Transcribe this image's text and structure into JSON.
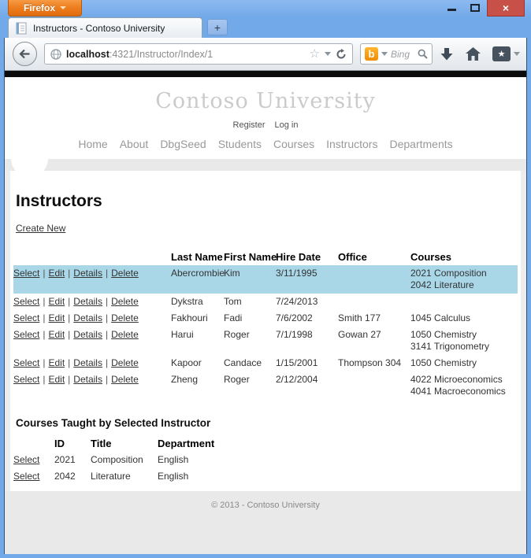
{
  "browser": {
    "menu_button_label": "Firefox",
    "tab_title": "Instructors - Contoso University",
    "new_tab_glyph": "+",
    "close_glyph": "×",
    "url": {
      "host": "localhost",
      "rest": ":4321/Instructor/Index/1"
    },
    "url_star_glyph": "☆",
    "search": {
      "engine_glyph": "b",
      "placeholder": "Bing"
    },
    "bookmark_star_glyph": "★"
  },
  "page": {
    "site_title": "Contoso University",
    "auth_links": {
      "register": "Register",
      "login": "Log in"
    },
    "nav": [
      "Home",
      "About",
      "DbgSeed",
      "Students",
      "Courses",
      "Instructors",
      "Departments"
    ],
    "heading": "Instructors",
    "create_new_label": "Create New",
    "separator": "|",
    "instructors_table": {
      "actions": [
        "Select",
        "Edit",
        "Details",
        "Delete"
      ],
      "headers": [
        "Last Name",
        "First Name",
        "Hire Date",
        "Office",
        "Courses"
      ],
      "rows": [
        {
          "selected": true,
          "last_name": "Abercrombie",
          "first_name": "Kim",
          "hire_date": "3/11/1995",
          "office": "",
          "courses": "2021 Composition\n2042 Literature"
        },
        {
          "selected": false,
          "last_name": "Dykstra",
          "first_name": "Tom",
          "hire_date": "7/24/2013",
          "office": "",
          "courses": ""
        },
        {
          "selected": false,
          "last_name": "Fakhouri",
          "first_name": "Fadi",
          "hire_date": "7/6/2002",
          "office": "Smith 177",
          "courses": "1045 Calculus"
        },
        {
          "selected": false,
          "last_name": "Harui",
          "first_name": "Roger",
          "hire_date": "7/1/1998",
          "office": "Gowan 27",
          "courses": "1050 Chemistry\n3141 Trigonometry"
        },
        {
          "selected": false,
          "last_name": "Kapoor",
          "first_name": "Candace",
          "hire_date": "1/15/2001",
          "office": "Thompson 304",
          "courses": "1050 Chemistry"
        },
        {
          "selected": false,
          "last_name": "Zheng",
          "first_name": "Roger",
          "hire_date": "2/12/2004",
          "office": "",
          "courses": "4022 Microeconomics\n4041 Macroeconomics"
        }
      ]
    },
    "courses_section": {
      "heading": "Courses Taught by Selected Instructor",
      "select_label": "Select",
      "headers": [
        "ID",
        "Title",
        "Department"
      ],
      "rows": [
        {
          "id": "2021",
          "title": "Composition",
          "department": "English"
        },
        {
          "id": "2042",
          "title": "Literature",
          "department": "English"
        }
      ]
    },
    "footer_text": "© 2013 - Contoso University"
  },
  "colors": {
    "titlebar_blue": "#72a9e8",
    "close_red": "#c75049",
    "firefox_orange": "#ee7f1f",
    "selected_row_blue": "#a9d7e8",
    "band_gray": "#e9e9e9"
  }
}
